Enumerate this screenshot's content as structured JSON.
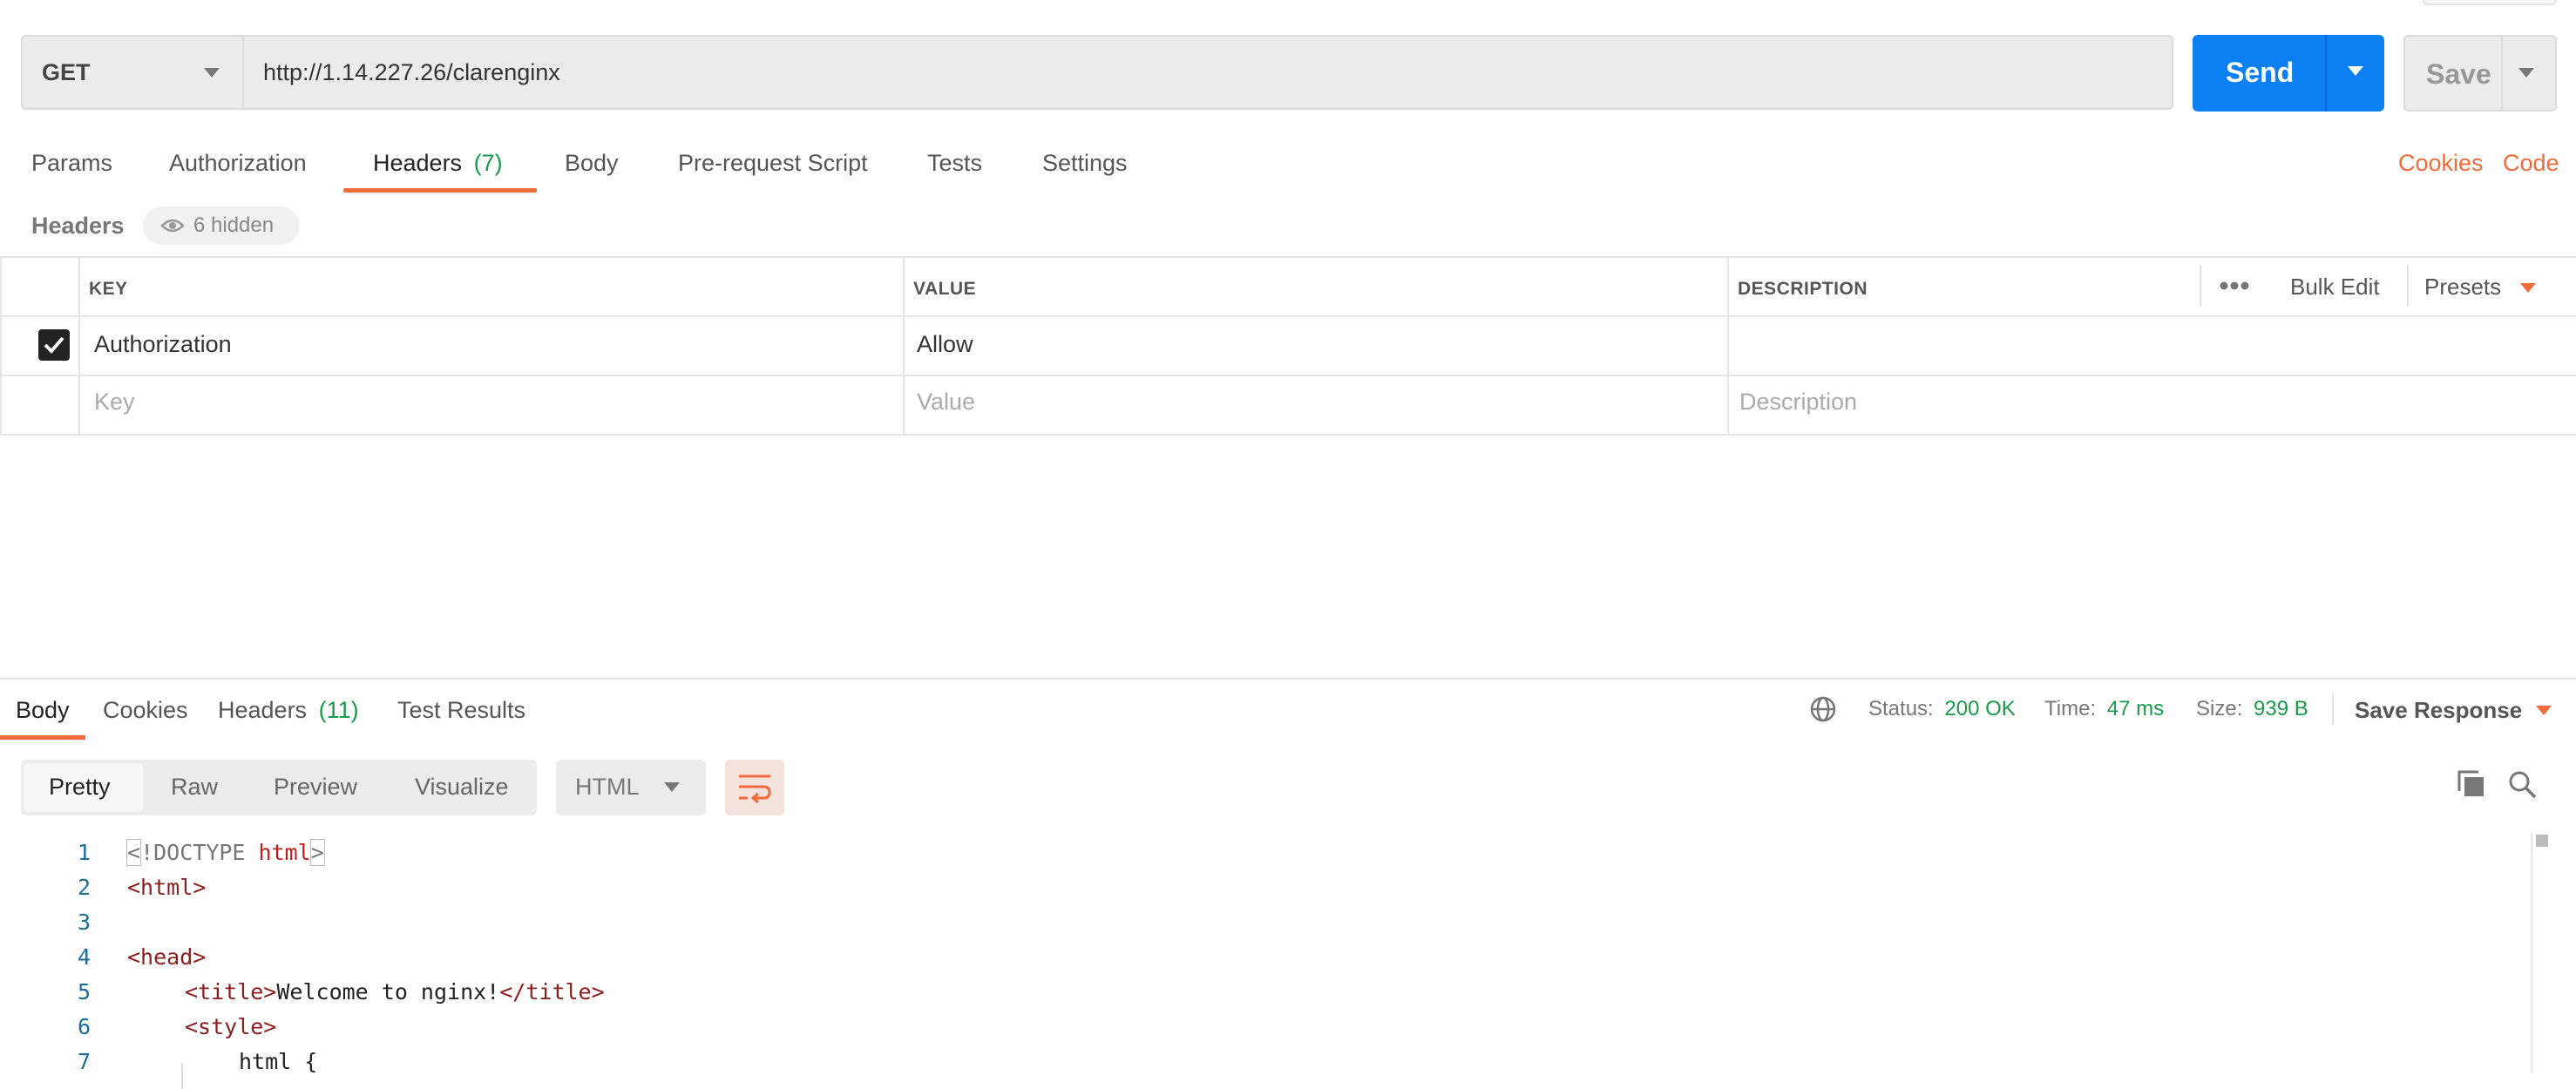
{
  "request": {
    "method": "GET",
    "url": "http://1.14.227.26/clarenginx",
    "send_label": "Send",
    "save_label": "Save"
  },
  "request_tabs": [
    {
      "label": "Params"
    },
    {
      "label": "Authorization"
    },
    {
      "label": "Headers",
      "count": "(7)"
    },
    {
      "label": "Body"
    },
    {
      "label": "Pre-request Script"
    },
    {
      "label": "Tests"
    },
    {
      "label": "Settings"
    }
  ],
  "request_links": {
    "cookies": "Cookies",
    "code": "Code"
  },
  "headers_section": {
    "title": "Headers",
    "hidden": "6 hidden"
  },
  "table": {
    "columns": {
      "key": "KEY",
      "value": "VALUE",
      "description": "DESCRIPTION"
    },
    "bulk_edit": "Bulk Edit",
    "presets": "Presets",
    "rows": [
      {
        "checked": true,
        "key": "Authorization",
        "value": "Allow",
        "description": ""
      }
    ],
    "placeholders": {
      "key": "Key",
      "value": "Value",
      "description": "Description"
    }
  },
  "response_tabs": [
    {
      "label": "Body"
    },
    {
      "label": "Cookies"
    },
    {
      "label": "Headers",
      "count": "(11)"
    },
    {
      "label": "Test Results"
    }
  ],
  "status": {
    "status_label": "Status:",
    "status_value": "200 OK",
    "time_label": "Time:",
    "time_value": "47 ms",
    "size_label": "Size:",
    "size_value": "939 B",
    "save_response": "Save Response"
  },
  "format_tabs": [
    "Pretty",
    "Raw",
    "Preview",
    "Visualize"
  ],
  "language": "HTML",
  "code_lines": [
    {
      "n": "1"
    },
    {
      "n": "2"
    },
    {
      "n": "3"
    },
    {
      "n": "4"
    },
    {
      "n": "5"
    },
    {
      "n": "6"
    },
    {
      "n": "7"
    }
  ],
  "code_text": {
    "l1_a": "<",
    "l1_b": "!DOCTYPE ",
    "l1_c": "html",
    "l1_d": ">",
    "l2": "<html>",
    "l4": "<head>",
    "l5_a": "<title>",
    "l5_b": "Welcome to nginx!",
    "l5_c": "</title>",
    "l6": "<style>",
    "l7": "html {"
  },
  "colors": {
    "accent": "#f26b3a",
    "primary": "#0c7ff2",
    "success": "#1a9a4a"
  }
}
